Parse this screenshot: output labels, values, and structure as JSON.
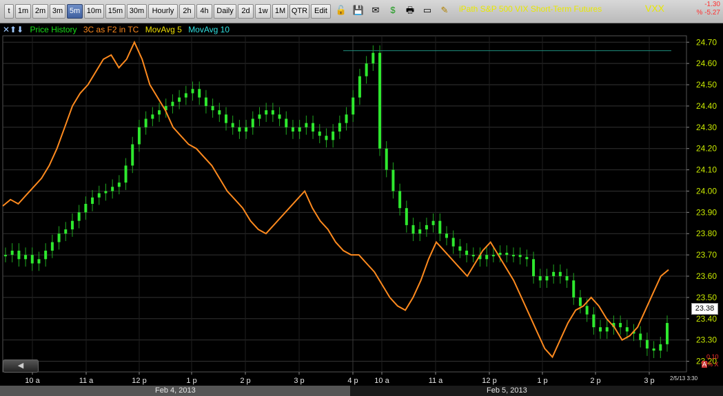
{
  "toolbar": {
    "intervals": [
      {
        "label": "t",
        "active": false
      },
      {
        "label": "1m",
        "active": false
      },
      {
        "label": "2m",
        "active": false
      },
      {
        "label": "3m",
        "active": false
      },
      {
        "label": "5m",
        "active": true
      },
      {
        "label": "10m",
        "active": false
      },
      {
        "label": "15m",
        "active": false
      },
      {
        "label": "30m",
        "active": false
      },
      {
        "label": "Hourly",
        "active": false
      },
      {
        "label": "2h",
        "active": false
      },
      {
        "label": "4h",
        "active": false
      },
      {
        "label": "Daily",
        "active": false
      },
      {
        "label": "2d",
        "active": false
      },
      {
        "label": "1w",
        "active": false
      },
      {
        "label": "1M",
        "active": false
      },
      {
        "label": "QTR",
        "active": false
      },
      {
        "label": "Edit",
        "active": false
      }
    ],
    "icons": [
      "lock-icon",
      "save-icon",
      "mail-icon",
      "dollar-icon",
      "print-icon",
      "card-icon",
      "pencil-icon"
    ]
  },
  "header": {
    "title": "iPath S&P 500 VIX Short-Term Futures",
    "symbol": "VXX",
    "change": "-1.30",
    "change_pct": "% -5.27"
  },
  "legend": {
    "arrows": "✕⬆⬇",
    "items": [
      {
        "label": "Price History",
        "color": "#18e018"
      },
      {
        "label": "3C as F2 in TC",
        "color": "#ff8a1e"
      },
      {
        "label": "MovAvg 5",
        "color": "#f0e000"
      },
      {
        "label": "MovAvg 10",
        "color": "#30e0e0"
      }
    ]
  },
  "price_tag": "23.38",
  "corner": {
    "value": "0.10",
    "mode": "A",
    "pct_x": "% X"
  },
  "timestamp": "2/5/13 3:30",
  "dates": [
    "Feb 4, 2013",
    "Feb 5, 2013"
  ],
  "colors": {
    "candle": "#2ee82e",
    "indicator": "#ff8a1e",
    "ref_line": "#1f8f7f",
    "grid": "#333333",
    "axis_text": "#c8e800"
  },
  "chart_data": {
    "type": "line",
    "title": "iPath S&P 500 VIX Short-Term Futures",
    "y_ticks": [
      23.2,
      23.3,
      23.4,
      23.5,
      23.6,
      23.7,
      23.8,
      23.9,
      24.0,
      24.1,
      24.2,
      24.3,
      24.4,
      24.5,
      24.6,
      24.7
    ],
    "ylim": [
      23.15,
      24.73
    ],
    "x_ticks": [
      "10 a",
      "11 a",
      "12 p",
      "1 p",
      "2 p",
      "3 p",
      "4 p",
      "10 a",
      "11 a",
      "12 p",
      "1 p",
      "2 p",
      "3 p"
    ],
    "grid": true,
    "reference_line": 24.66,
    "series": [
      {
        "name": "Price History",
        "kind": "candlestick",
        "values": [
          23.7,
          23.72,
          23.68,
          23.7,
          23.66,
          23.68,
          23.72,
          23.76,
          23.8,
          23.82,
          23.86,
          23.9,
          23.94,
          23.97,
          23.99,
          24.0,
          24.02,
          24.04,
          24.12,
          24.22,
          24.3,
          24.34,
          24.36,
          24.38,
          24.4,
          24.42,
          24.44,
          24.46,
          24.48,
          24.44,
          24.4,
          24.38,
          24.36,
          24.32,
          24.3,
          24.28,
          24.3,
          24.34,
          24.36,
          24.38,
          24.36,
          24.34,
          24.3,
          24.28,
          24.3,
          24.32,
          24.28,
          24.26,
          24.24,
          24.28,
          24.32,
          24.36,
          24.44,
          24.54,
          24.6,
          24.65,
          24.2,
          24.1,
          24.0,
          23.92,
          23.84,
          23.8,
          23.82,
          23.84,
          23.86,
          23.8,
          23.78,
          23.74,
          23.72,
          23.7,
          23.7,
          23.68,
          23.7,
          23.7,
          23.71,
          23.7,
          23.7,
          23.69,
          23.68,
          23.6,
          23.58,
          23.6,
          23.62,
          23.6,
          23.58,
          23.5,
          23.46,
          23.42,
          23.36,
          23.34,
          23.36,
          23.38,
          23.36,
          23.34,
          23.33,
          23.3,
          23.26,
          23.25,
          23.28,
          23.38
        ]
      },
      {
        "name": "3C as F2 in TC",
        "kind": "line",
        "values": [
          23.93,
          23.96,
          23.94,
          23.98,
          24.02,
          24.06,
          24.12,
          24.2,
          24.3,
          24.4,
          24.46,
          24.5,
          24.56,
          24.62,
          24.64,
          24.58,
          24.62,
          24.7,
          24.62,
          24.5,
          24.44,
          24.38,
          24.3,
          24.26,
          24.22,
          24.2,
          24.16,
          24.12,
          24.06,
          24.0,
          23.96,
          23.92,
          23.86,
          23.82,
          23.8,
          23.84,
          23.88,
          23.92,
          23.96,
          24.0,
          23.92,
          23.86,
          23.82,
          23.76,
          23.72,
          23.7,
          23.7,
          23.66,
          23.62,
          23.56,
          23.5,
          23.46,
          23.44,
          23.5,
          23.58,
          23.68,
          23.76,
          23.72,
          23.68,
          23.64,
          23.6,
          23.66,
          23.72,
          23.76,
          23.7,
          23.64,
          23.58,
          23.5,
          23.42,
          23.34,
          23.26,
          23.22,
          23.3,
          23.38,
          23.44,
          23.46,
          23.5,
          23.46,
          23.4,
          23.36,
          23.3,
          23.32,
          23.36,
          23.44,
          23.52,
          23.6,
          23.63
        ]
      }
    ]
  }
}
